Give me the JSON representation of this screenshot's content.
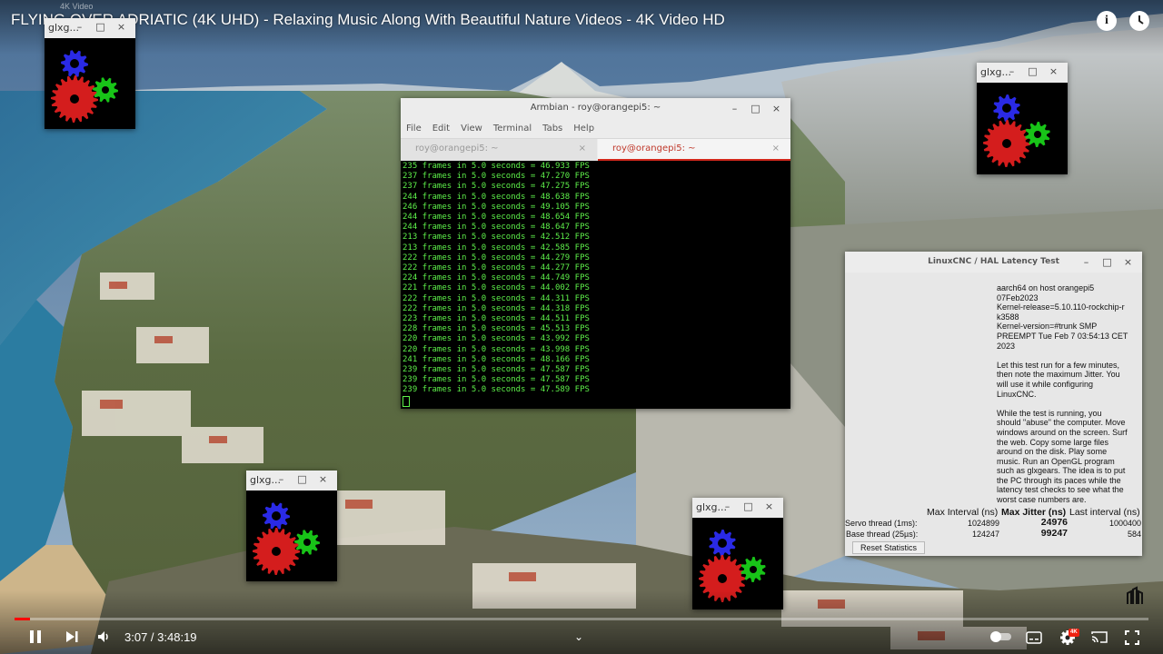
{
  "youtube": {
    "title": "FLYING OVER ADRIATIC (4K UHD) - Relaxing Music Along With Beautiful Nature Videos - 4K Video HD",
    "small_label": "4K Video",
    "time_current": "3:07",
    "time_separator": " / ",
    "time_total": "3:48:19",
    "progress_fraction": 0.0136,
    "quality_badge": "4K",
    "accent_color": "#ff0000"
  },
  "gears_windows": [
    {
      "title": "glxg..."
    },
    {
      "title": "glxg..."
    },
    {
      "title": "glxg..."
    },
    {
      "title": "glxg..."
    }
  ],
  "window_buttons": {
    "minimize": "–",
    "maximize": "□",
    "close": "×"
  },
  "terminal": {
    "title": "Armbian - roy@orangepi5: ~",
    "menu": [
      "File",
      "Edit",
      "View",
      "Terminal",
      "Tabs",
      "Help"
    ],
    "tabs": [
      {
        "label": "roy@orangepi5: ~",
        "close": "×"
      },
      {
        "label": "roy@orangepi5: ~",
        "close": "×"
      }
    ],
    "lines": [
      "235 frames in 5.0 seconds = 46.933 FPS",
      "237 frames in 5.0 seconds = 47.270 FPS",
      "237 frames in 5.0 seconds = 47.275 FPS",
      "244 frames in 5.0 seconds = 48.638 FPS",
      "246 frames in 5.0 seconds = 49.105 FPS",
      "244 frames in 5.0 seconds = 48.654 FPS",
      "244 frames in 5.0 seconds = 48.647 FPS",
      "213 frames in 5.0 seconds = 42.512 FPS",
      "213 frames in 5.0 seconds = 42.585 FPS",
      "222 frames in 5.0 seconds = 44.279 FPS",
      "222 frames in 5.0 seconds = 44.277 FPS",
      "224 frames in 5.0 seconds = 44.749 FPS",
      "221 frames in 5.0 seconds = 44.002 FPS",
      "222 frames in 5.0 seconds = 44.311 FPS",
      "222 frames in 5.0 seconds = 44.318 FPS",
      "223 frames in 5.0 seconds = 44.511 FPS",
      "228 frames in 5.0 seconds = 45.513 FPS",
      "220 frames in 5.0 seconds = 43.992 FPS",
      "220 frames in 5.0 seconds = 43.998 FPS",
      "241 frames in 5.0 seconds = 48.166 FPS",
      "239 frames in 5.0 seconds = 47.587 FPS",
      "239 frames in 5.0 seconds = 47.587 FPS",
      "239 frames in 5.0 seconds = 47.589 FPS"
    ]
  },
  "latency": {
    "title": "LinuxCNC / HAL Latency Test",
    "info_lines": [
      "aarch64 on host orangepi5",
      "07Feb2023",
      "Kernel-release=5.10.110-rockchip-r",
      "k3588",
      "Kernel-version=#trunk SMP",
      "PREEMPT Tue Feb 7 03:54:13 CET",
      "2023"
    ],
    "para1_lines": [
      "Let this test run for a few minutes,",
      "then note the maximum Jitter. You",
      "will use it while configuring",
      "LinuxCNC."
    ],
    "para2_lines": [
      "While the test is running, you",
      "should \"abuse\" the computer. Move",
      "windows around on the screen. Surf",
      "the web. Copy some large files",
      "around on the disk. Play some",
      "music. Run an OpenGL program",
      "such as glxgears. The idea is to put",
      "the PC through its paces while the",
      "latency test checks to see what the",
      "worst case numbers are."
    ],
    "headers": {
      "max_interval": "Max Interval (ns)",
      "max_jitter": "Max Jitter (ns)",
      "last_interval": "Last interval (ns)"
    },
    "rows": [
      {
        "label": "Servo thread (1ms):",
        "max_interval": "1024899",
        "max_jitter": "24976",
        "last_interval": "1000400"
      },
      {
        "label": "Base thread (25µs):",
        "max_interval": "124247",
        "max_jitter": "99247",
        "last_interval": "584"
      }
    ],
    "reset_label": "Reset Statistics"
  }
}
